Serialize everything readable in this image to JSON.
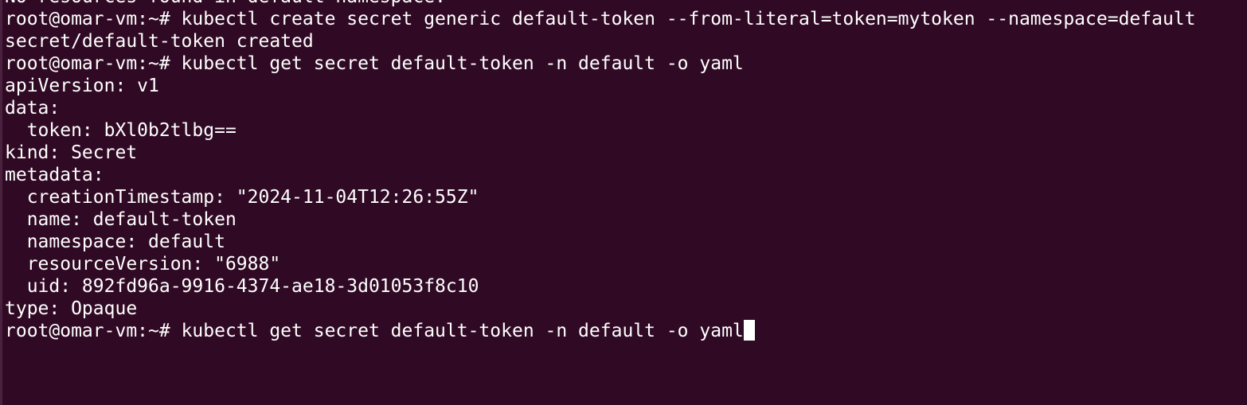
{
  "terminal": {
    "background": "#300a24",
    "foreground": "#ffffff",
    "lines": [
      "No resources found in default namespace.",
      "root@omar-vm:~# kubectl create secret generic default-token --from-literal=token=mytoken --namespace=default",
      "secret/default-token created",
      "root@omar-vm:~# kubectl get secret default-token -n default -o yaml",
      "apiVersion: v1",
      "data:",
      "  token: bXl0b2tlbg==",
      "kind: Secret",
      "metadata:",
      "  creationTimestamp: \"2024-11-04T12:26:55Z\"",
      "  name: default-token",
      "  namespace: default",
      "  resourceVersion: \"6988\"",
      "  uid: 892fd96a-9916-4374-ae18-3d01053f8c10",
      "type: Opaque"
    ],
    "prompt": "root@omar-vm:~# ",
    "current_input": "kubectl get secret default-token -n default -o yaml"
  }
}
